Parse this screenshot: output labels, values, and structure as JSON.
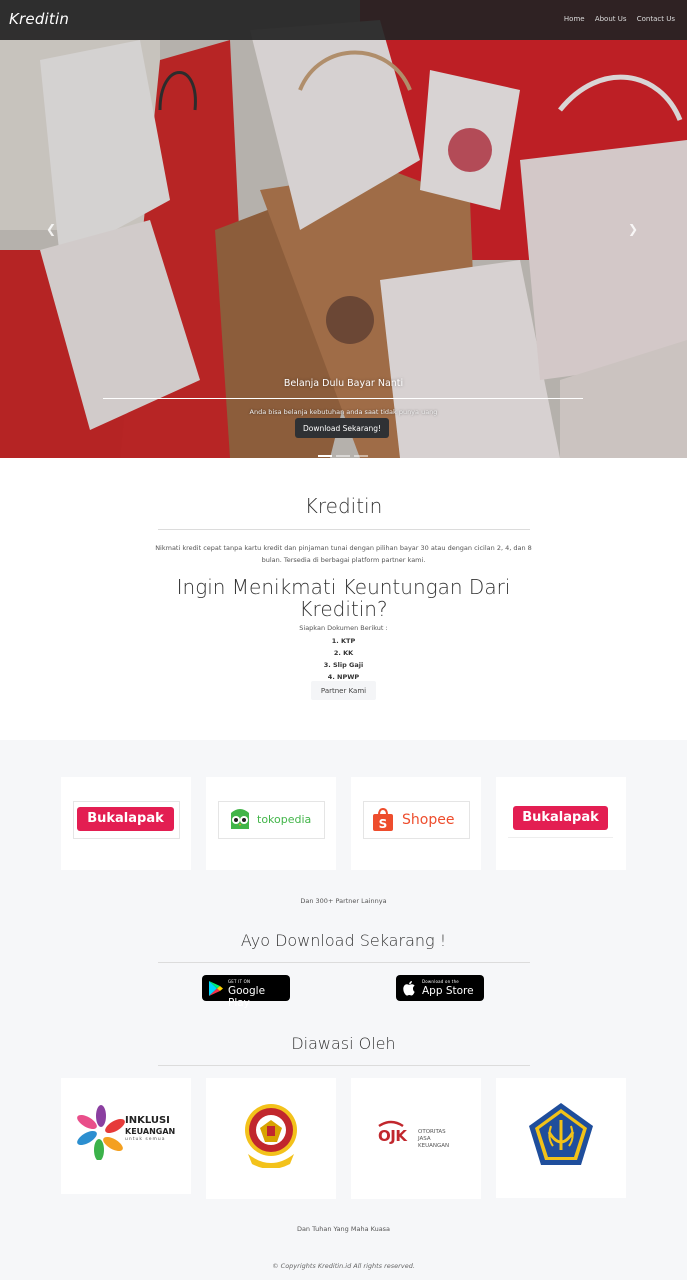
{
  "nav": {
    "brand": "Kreditin",
    "links": [
      "Home",
      "About Us",
      "Contact Us"
    ]
  },
  "hero": {
    "caption_title": "Belanja Dulu Bayar Nanti",
    "caption_subtitle": "Anda bisa belanja kebutuhan anda saat tidak punya uang",
    "button_label": "Download Sekarang!",
    "prev_icon": "chevron-left-icon",
    "next_icon": "chevron-right-icon",
    "slides_count": 3,
    "active_slide": 1
  },
  "about": {
    "title": "Kreditin",
    "description": "Nikmati kredit cepat tanpa kartu kredit dan pinjaman tunai dengan pilihan bayar 30 atau dengan cicilan 2, 4, dan 8 bulan. Tersedia di berbagai platform partner kami.",
    "benefit_title": "Ingin Menikmati Keuntungan Dari Kreditin?",
    "documents_heading": "Siapkan Dokumen Berikut :",
    "documents": [
      "1. KTP",
      "2. KK",
      "3. Slip Gaji",
      "4. NPWP"
    ],
    "partner_button": "Partner Kami"
  },
  "partners": {
    "logos": [
      "Bukalapak",
      "tokopedia",
      "Shopee",
      "Bukalapak"
    ],
    "more_text": "Dan 300+ Partner Lainnya"
  },
  "download": {
    "title": "Ayo Download Sekarang !",
    "google_play_small": "GET IT ON",
    "google_play_big": "Google Play",
    "app_store_small": "Download on the",
    "app_store_big": "App Store"
  },
  "supervised": {
    "title": "Diawasi Oleh",
    "inklusi_title": "INKLUSI",
    "inklusi_title2": "KEUANGAN",
    "inklusi_sub": "untuk semua",
    "ojk_logo": "OJK",
    "ojk_text": [
      "OTORITAS",
      "JASA",
      "KEUANGAN"
    ],
    "footer_note": "Dan Tuhan Yang Maha Kuasa",
    "copyright": "© Copyrights Kreditin.id All rights reserved."
  },
  "colors": {
    "bukalapak": "#e31e52",
    "tokopedia": "#42b549",
    "shopee": "#ee4d2d",
    "nav_bg": "#232323"
  }
}
